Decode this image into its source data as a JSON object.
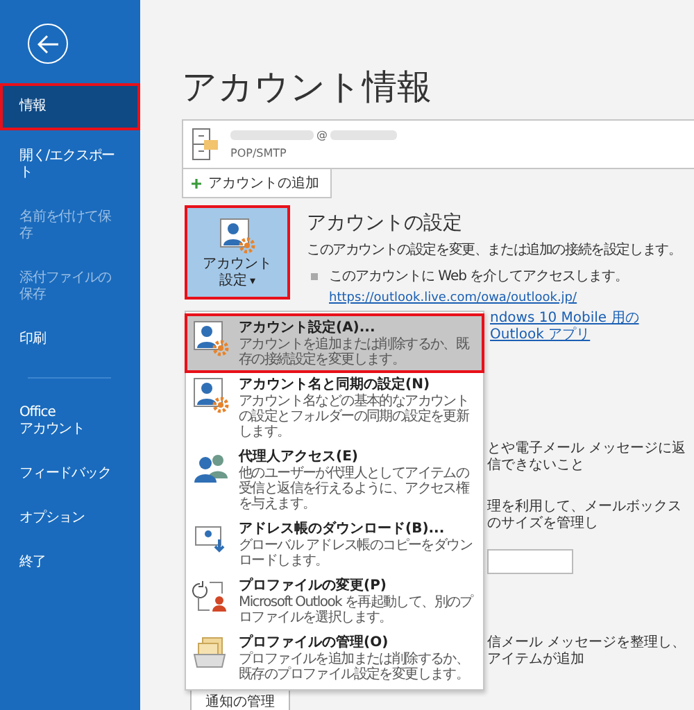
{
  "sidebar": {
    "items": [
      {
        "label": "情報",
        "selected": true,
        "disabled": false,
        "highlighted": true
      },
      {
        "label": "開く/エクスポート",
        "selected": false,
        "disabled": false,
        "highlighted": false
      },
      {
        "label": "名前を付けて保存",
        "selected": false,
        "disabled": true,
        "highlighted": false
      },
      {
        "label": "添付ファイルの保存",
        "selected": false,
        "disabled": true,
        "highlighted": false
      },
      {
        "label": "印刷",
        "selected": false,
        "disabled": false,
        "highlighted": false
      },
      {
        "kind": "divider"
      },
      {
        "label": "Office\nアカウント",
        "selected": false,
        "disabled": false,
        "highlighted": false
      },
      {
        "label": "フィードバック",
        "selected": false,
        "disabled": false,
        "highlighted": false
      },
      {
        "label": "オプション",
        "selected": false,
        "disabled": false,
        "highlighted": false
      },
      {
        "label": "終了",
        "selected": false,
        "disabled": false,
        "highlighted": false
      }
    ]
  },
  "title": "アカウント情報",
  "account": {
    "email": "@",
    "type": "POP/SMTP"
  },
  "add_account_button": "アカウントの追加",
  "account_settings": {
    "button_lines": [
      "アカウント",
      "設定"
    ],
    "caret": "▾",
    "highlighted": true,
    "heading": "アカウントの設定",
    "description": "このアカウントの設定を変更、または追加の接続を設定します。",
    "bullet": "このアカウントに Web を介してアクセスします。",
    "link": "https://outlook.live.com/owa/outlook.jp/",
    "link_2": "ndows 10 Mobile 用の Outlook アプリ"
  },
  "behind_texts": [
    "とや電子メール メッセージに返信できないこと",
    "理を利用して、メールボックスのサイズを管理し",
    "信メール メッセージを整理し、アイテムが追加"
  ],
  "notify_button": "通知の管理",
  "menu": [
    {
      "kind": "settings",
      "title": "アカウント設定(A)...",
      "description": "アカウントを追加または削除するか、既存の接続設定を変更します。",
      "selected": true,
      "highlighted": true
    },
    {
      "kind": "settings",
      "title": "アカウント名と同期の設定(N)",
      "description": "アカウント名などの基本的なアカウントの設定とフォルダーの同期の設定を更新します。",
      "selected": false,
      "highlighted": false
    },
    {
      "kind": "delegate",
      "title": "代理人アクセス(E)",
      "description": "他のユーザーが代理人としてアイテムの受信と返信を行えるように、アクセス権を与えます。",
      "selected": false,
      "highlighted": false
    },
    {
      "kind": "download",
      "title": "アドレス帳のダウンロード(B)...",
      "description": "グローバル アドレス帳のコピーをダウンロードします。",
      "selected": false,
      "highlighted": false
    },
    {
      "kind": "profile",
      "title": "プロファイルの変更(P)",
      "description": "Microsoft Outlook を再起動して、別のプロファイルを選択します。",
      "selected": false,
      "highlighted": false
    },
    {
      "kind": "manage",
      "title": "プロファイルの管理(O)",
      "description": "プロファイルを追加または削除するか、既存のプロファイル設定を変更します。",
      "selected": false,
      "highlighted": false
    }
  ]
}
